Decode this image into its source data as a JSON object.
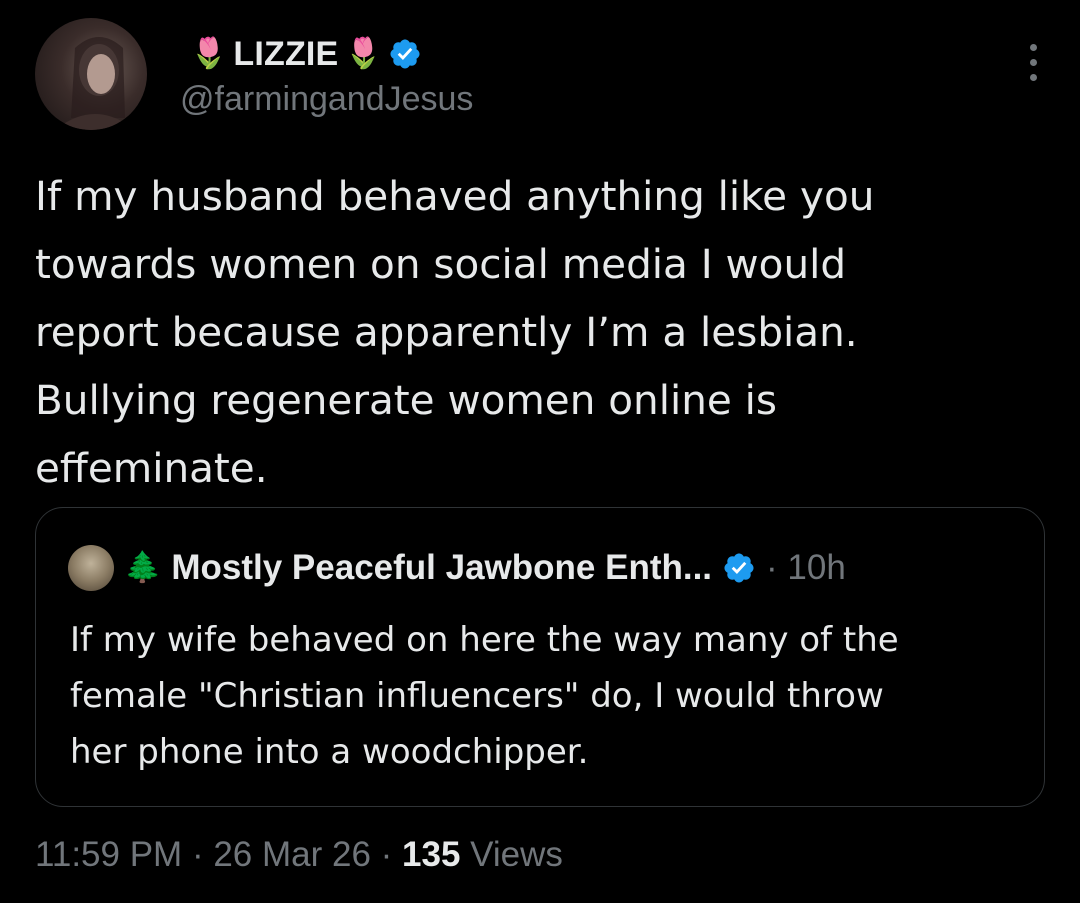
{
  "author": {
    "prefix_emoji": "🌷",
    "display_name": "LIZZIE",
    "suffix_emoji": "🌷",
    "handle": "@farmingandJesus"
  },
  "tweet": {
    "text": "If my husband behaved anything like you\ntowards women on social media I would\nreport because apparently I’m a lesbian.\nBullying regenerate women online is\neffeminate."
  },
  "quoted_tweet": {
    "emoji": "🌲",
    "display_name": "Mostly Peaceful Jawbone Enth...",
    "time": "· 10h",
    "text": "If my wife behaved on here the way many of the\nfemale \"Christian influencers\" do, I would throw\nher phone into a woodchipper."
  },
  "meta": {
    "time": "11:59 PM",
    "sep1": " · ",
    "date": "26 Mar 26",
    "sep2": " · ",
    "views_count": "135",
    "views_label": " Views"
  },
  "colors": {
    "background": "#000000",
    "text_primary": "#e7e9ea",
    "text_secondary": "#71767b",
    "verified_blue": "#1d9bf0",
    "border": "#2f3336"
  },
  "icons": {
    "verified": "verified-badge-icon",
    "more": "more-options-icon"
  }
}
